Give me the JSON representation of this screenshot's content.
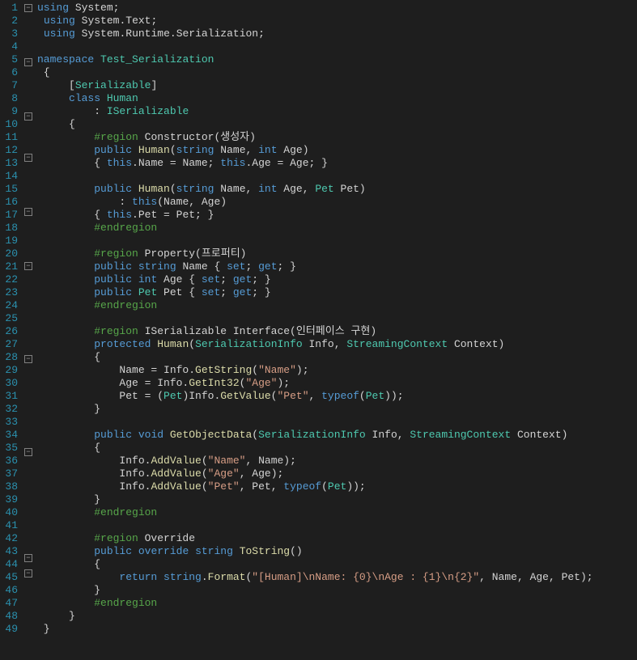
{
  "lineCount": 49,
  "foldMarks": {
    "1": "-",
    "5": "-",
    "6": "",
    "9": "-",
    "12": "-",
    "16": "-",
    "20": "-",
    "27": "-",
    "34": "-",
    "42": "-",
    "43": "-"
  },
  "lines": [
    [
      [
        "kw",
        "using"
      ],
      [
        "pl",
        " "
      ],
      [
        "ns",
        "System"
      ],
      [
        "pl",
        ";"
      ]
    ],
    [
      [
        "pl",
        " "
      ],
      [
        "kw",
        "using"
      ],
      [
        "pl",
        " "
      ],
      [
        "ns",
        "System"
      ],
      [
        "pl",
        "."
      ],
      [
        "ns",
        "Text"
      ],
      [
        "pl",
        ";"
      ]
    ],
    [
      [
        "pl",
        " "
      ],
      [
        "kw",
        "using"
      ],
      [
        "pl",
        " "
      ],
      [
        "ns",
        "System"
      ],
      [
        "pl",
        "."
      ],
      [
        "ns",
        "Runtime"
      ],
      [
        "pl",
        "."
      ],
      [
        "ns",
        "Serialization"
      ],
      [
        "pl",
        ";"
      ]
    ],
    [
      [
        "pl",
        ""
      ]
    ],
    [
      [
        "kw",
        "namespace"
      ],
      [
        "pl",
        " "
      ],
      [
        "type",
        "Test_Serialization"
      ]
    ],
    [
      [
        "pl",
        " {"
      ]
    ],
    [
      [
        "pl",
        "     ["
      ],
      [
        "type",
        "Serializable"
      ],
      [
        "pl",
        "]"
      ]
    ],
    [
      [
        "pl",
        "     "
      ],
      [
        "kw",
        "class"
      ],
      [
        "pl",
        " "
      ],
      [
        "type",
        "Human"
      ]
    ],
    [
      [
        "pl",
        "         : "
      ],
      [
        "type",
        "ISerializable"
      ]
    ],
    [
      [
        "pl",
        "     {"
      ]
    ],
    [
      [
        "pl",
        "         "
      ],
      [
        "cm",
        "#region"
      ],
      [
        "pl",
        " "
      ],
      [
        "pl",
        "Constructor(생성자)"
      ]
    ],
    [
      [
        "pl",
        "         "
      ],
      [
        "kw",
        "public"
      ],
      [
        "pl",
        " "
      ],
      [
        "id",
        "Human"
      ],
      [
        "pl",
        "("
      ],
      [
        "kw",
        "string"
      ],
      [
        "pl",
        " Name, "
      ],
      [
        "kw",
        "int"
      ],
      [
        "pl",
        " Age)"
      ]
    ],
    [
      [
        "pl",
        "         { "
      ],
      [
        "kw",
        "this"
      ],
      [
        "pl",
        ".Name = Name; "
      ],
      [
        "kw",
        "this"
      ],
      [
        "pl",
        ".Age = Age; }"
      ]
    ],
    [
      [
        "pl",
        ""
      ]
    ],
    [
      [
        "pl",
        "         "
      ],
      [
        "kw",
        "public"
      ],
      [
        "pl",
        " "
      ],
      [
        "id",
        "Human"
      ],
      [
        "pl",
        "("
      ],
      [
        "kw",
        "string"
      ],
      [
        "pl",
        " Name, "
      ],
      [
        "kw",
        "int"
      ],
      [
        "pl",
        " Age, "
      ],
      [
        "type",
        "Pet"
      ],
      [
        "pl",
        " Pet)"
      ]
    ],
    [
      [
        "pl",
        "             : "
      ],
      [
        "kw",
        "this"
      ],
      [
        "pl",
        "(Name, Age)"
      ]
    ],
    [
      [
        "pl",
        "         { "
      ],
      [
        "kw",
        "this"
      ],
      [
        "pl",
        ".Pet = Pet; }"
      ]
    ],
    [
      [
        "pl",
        "         "
      ],
      [
        "cm",
        "#endregion"
      ]
    ],
    [
      [
        "pl",
        ""
      ]
    ],
    [
      [
        "pl",
        "         "
      ],
      [
        "cm",
        "#region"
      ],
      [
        "pl",
        " Property(프로퍼티)"
      ]
    ],
    [
      [
        "pl",
        "         "
      ],
      [
        "kw",
        "public"
      ],
      [
        "pl",
        " "
      ],
      [
        "kw",
        "string"
      ],
      [
        "pl",
        " Name { "
      ],
      [
        "kw",
        "set"
      ],
      [
        "pl",
        "; "
      ],
      [
        "kw",
        "get"
      ],
      [
        "pl",
        "; }"
      ]
    ],
    [
      [
        "pl",
        "         "
      ],
      [
        "kw",
        "public"
      ],
      [
        "pl",
        " "
      ],
      [
        "kw",
        "int"
      ],
      [
        "pl",
        " Age { "
      ],
      [
        "kw",
        "set"
      ],
      [
        "pl",
        "; "
      ],
      [
        "kw",
        "get"
      ],
      [
        "pl",
        "; }"
      ]
    ],
    [
      [
        "pl",
        "         "
      ],
      [
        "kw",
        "public"
      ],
      [
        "pl",
        " "
      ],
      [
        "type",
        "Pet"
      ],
      [
        "pl",
        " Pet { "
      ],
      [
        "kw",
        "set"
      ],
      [
        "pl",
        "; "
      ],
      [
        "kw",
        "get"
      ],
      [
        "pl",
        "; }"
      ]
    ],
    [
      [
        "pl",
        "         "
      ],
      [
        "cm",
        "#endregion"
      ]
    ],
    [
      [
        "pl",
        ""
      ]
    ],
    [
      [
        "pl",
        "         "
      ],
      [
        "cm",
        "#region"
      ],
      [
        "pl",
        " ISerializable Interface(인터페이스 구현)"
      ]
    ],
    [
      [
        "pl",
        "         "
      ],
      [
        "kw",
        "protected"
      ],
      [
        "pl",
        " "
      ],
      [
        "id",
        "Human"
      ],
      [
        "pl",
        "("
      ],
      [
        "type",
        "SerializationInfo"
      ],
      [
        "pl",
        " Info, "
      ],
      [
        "type",
        "StreamingContext"
      ],
      [
        "pl",
        " Context)"
      ]
    ],
    [
      [
        "pl",
        "         {"
      ]
    ],
    [
      [
        "pl",
        "             Name = Info."
      ],
      [
        "id",
        "GetString"
      ],
      [
        "pl",
        "("
      ],
      [
        "str",
        "\"Name\""
      ],
      [
        "pl",
        ");"
      ]
    ],
    [
      [
        "pl",
        "             Age = Info."
      ],
      [
        "id",
        "GetInt32"
      ],
      [
        "pl",
        "("
      ],
      [
        "str",
        "\"Age\""
      ],
      [
        "pl",
        ");"
      ]
    ],
    [
      [
        "pl",
        "             Pet = ("
      ],
      [
        "type",
        "Pet"
      ],
      [
        "pl",
        ")Info."
      ],
      [
        "id",
        "GetValue"
      ],
      [
        "pl",
        "("
      ],
      [
        "str",
        "\"Pet\""
      ],
      [
        "pl",
        ", "
      ],
      [
        "kw",
        "typeof"
      ],
      [
        "pl",
        "("
      ],
      [
        "type",
        "Pet"
      ],
      [
        "pl",
        "));"
      ]
    ],
    [
      [
        "pl",
        "         }"
      ]
    ],
    [
      [
        "pl",
        ""
      ]
    ],
    [
      [
        "pl",
        "         "
      ],
      [
        "kw",
        "public"
      ],
      [
        "pl",
        " "
      ],
      [
        "kw",
        "void"
      ],
      [
        "pl",
        " "
      ],
      [
        "id",
        "GetObjectData"
      ],
      [
        "pl",
        "("
      ],
      [
        "type",
        "SerializationInfo"
      ],
      [
        "pl",
        " Info, "
      ],
      [
        "type",
        "StreamingContext"
      ],
      [
        "pl",
        " Context)"
      ]
    ],
    [
      [
        "pl",
        "         {"
      ]
    ],
    [
      [
        "pl",
        "             Info."
      ],
      [
        "id",
        "AddValue"
      ],
      [
        "pl",
        "("
      ],
      [
        "str",
        "\"Name\""
      ],
      [
        "pl",
        ", Name);"
      ]
    ],
    [
      [
        "pl",
        "             Info."
      ],
      [
        "id",
        "AddValue"
      ],
      [
        "pl",
        "("
      ],
      [
        "str",
        "\"Age\""
      ],
      [
        "pl",
        ", Age);"
      ]
    ],
    [
      [
        "pl",
        "             Info."
      ],
      [
        "id",
        "AddValue"
      ],
      [
        "pl",
        "("
      ],
      [
        "str",
        "\"Pet\""
      ],
      [
        "pl",
        ", Pet, "
      ],
      [
        "kw",
        "typeof"
      ],
      [
        "pl",
        "("
      ],
      [
        "type",
        "Pet"
      ],
      [
        "pl",
        "));"
      ]
    ],
    [
      [
        "pl",
        "         }"
      ]
    ],
    [
      [
        "pl",
        "         "
      ],
      [
        "cm",
        "#endregion"
      ]
    ],
    [
      [
        "pl",
        ""
      ]
    ],
    [
      [
        "pl",
        "         "
      ],
      [
        "cm",
        "#region"
      ],
      [
        "pl",
        " Override"
      ]
    ],
    [
      [
        "pl",
        "         "
      ],
      [
        "kw",
        "public"
      ],
      [
        "pl",
        " "
      ],
      [
        "kw",
        "override"
      ],
      [
        "pl",
        " "
      ],
      [
        "kw",
        "string"
      ],
      [
        "pl",
        " "
      ],
      [
        "id",
        "ToString"
      ],
      [
        "pl",
        "()"
      ]
    ],
    [
      [
        "pl",
        "         {"
      ]
    ],
    [
      [
        "pl",
        "             "
      ],
      [
        "kw",
        "return"
      ],
      [
        "pl",
        " "
      ],
      [
        "kw",
        "string"
      ],
      [
        "pl",
        "."
      ],
      [
        "id",
        "Format"
      ],
      [
        "pl",
        "("
      ],
      [
        "str",
        "\"[Human]\\nName: {0}\\nAge : {1}\\n{2}\""
      ],
      [
        "pl",
        ", Name, Age, Pet);"
      ]
    ],
    [
      [
        "pl",
        "         }"
      ]
    ],
    [
      [
        "pl",
        "         "
      ],
      [
        "cm",
        "#endregion"
      ]
    ],
    [
      [
        "pl",
        "     }"
      ]
    ],
    [
      [
        "pl",
        " }"
      ]
    ]
  ]
}
